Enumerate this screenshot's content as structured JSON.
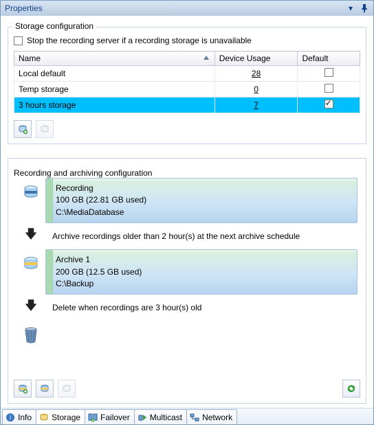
{
  "title": "Properties",
  "storage_config": {
    "legend": "Storage configuration",
    "stop_cb_label": "Stop the recording server if a recording storage is unavailable",
    "stop_cb_checked": false,
    "columns": {
      "name": "Name",
      "usage": "Device Usage",
      "default": "Default"
    },
    "rows": [
      {
        "name": "Local default",
        "usage": "28",
        "default": false,
        "selected": false
      },
      {
        "name": "Temp storage",
        "usage": "0",
        "default": false,
        "selected": false
      },
      {
        "name": "3 hours storage",
        "usage": "7",
        "default": true,
        "selected": true
      }
    ]
  },
  "rec_arch": {
    "legend": "Recording and archiving configuration",
    "recording": {
      "title": "Recording",
      "quota": "100 GB (22.81 GB used)",
      "path": "C:\\MediaDatabase"
    },
    "archive_rule": "Archive recordings older than 2 hour(s) at the next archive schedule",
    "archive": {
      "title": "Archive 1",
      "quota": "200 GB (12.5 GB used)",
      "path": "C:\\Backup"
    },
    "delete_rule": "Delete when recordings are 3 hour(s) old"
  },
  "tabs": [
    {
      "id": "info",
      "label": "Info"
    },
    {
      "id": "storage",
      "label": "Storage"
    },
    {
      "id": "failover",
      "label": "Failover"
    },
    {
      "id": "multicast",
      "label": "Multicast"
    },
    {
      "id": "network",
      "label": "Network"
    }
  ],
  "active_tab": "storage"
}
